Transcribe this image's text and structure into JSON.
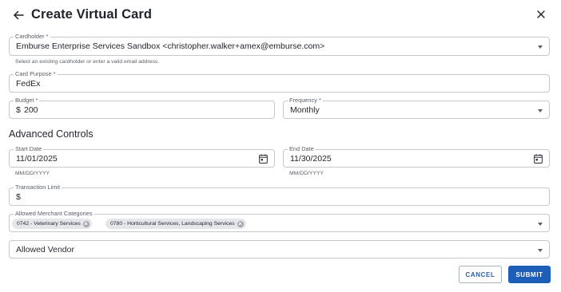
{
  "dialog": {
    "title": "Create Virtual Card"
  },
  "form": {
    "cardholder": {
      "label": "Cardholder *",
      "value": "Emburse Enterprise Services Sandbox <christopher.walker+amex@emburse.com>",
      "helper": "Select an existing cardholder or enter a valid email address."
    },
    "card_purpose": {
      "label": "Card Purpose *",
      "value": "FedEx"
    },
    "budget": {
      "label": "Budget *",
      "currency_symbol": "$",
      "value": "200"
    },
    "frequency": {
      "label": "Frequency *",
      "value": "Monthly"
    }
  },
  "advanced": {
    "title": "Advanced Controls",
    "start_date": {
      "label": "Start Date",
      "value": "11/01/2025",
      "helper": "MM/DD/YYYY"
    },
    "end_date": {
      "label": "End Date",
      "value": "11/30/2025",
      "helper": "MM/DD/YYYY"
    },
    "transaction_limit": {
      "label": "Transaction Limit",
      "currency_symbol": "$",
      "value": ""
    },
    "merchant_categories": {
      "label": "Allowed Merchant Categories",
      "chips": [
        "0742 - Veterinary Services",
        "0780 - Horticultural Services, Landscaping Services"
      ]
    },
    "allowed_vendor": {
      "placeholder": "Allowed Vendor"
    }
  },
  "actions": {
    "cancel_label": "CANCEL",
    "submit_label": "SUBMIT"
  },
  "icons": {
    "back": "arrow-left-icon",
    "close": "close-icon",
    "calendar": "calendar-icon",
    "chip_delete": "cancel-circle-icon",
    "dropdown": "caret-down-icon"
  },
  "colors": {
    "primary": "#1d5fb8",
    "border": "#c4c7cc",
    "chip_bg": "#e4e6e9",
    "text": "#1f2329"
  }
}
